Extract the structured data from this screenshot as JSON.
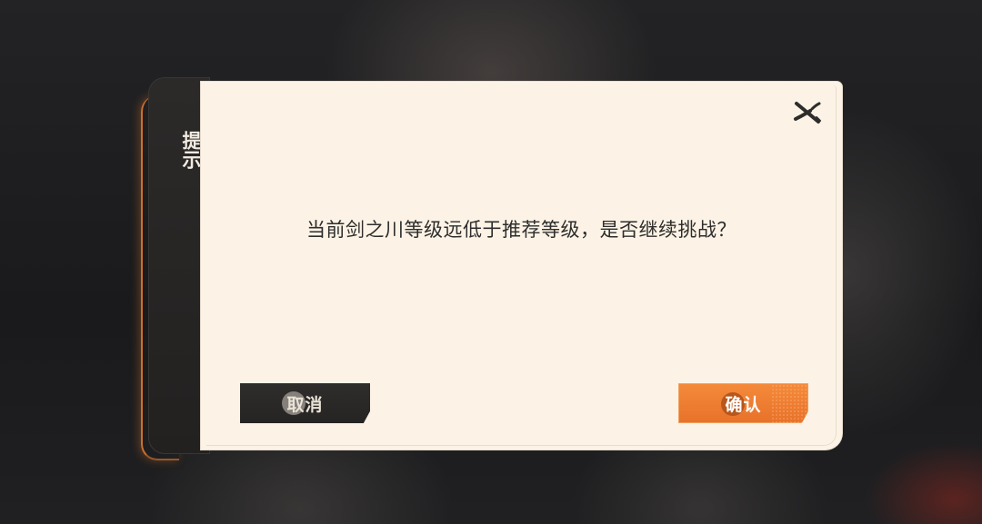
{
  "dialog": {
    "title": "提示",
    "message": "当前剑之川等级远低于推荐等级，是否继续挑战？",
    "close_icon": "close-icon",
    "buttons": {
      "cancel_label": "取消",
      "confirm_label": "确认"
    }
  },
  "colors": {
    "panel_bg": "#fcf3e6",
    "tab_bg": "#2c2a29",
    "accent_orange": "#f0802f",
    "cancel_bg": "#2f2d2c",
    "text_dark": "#2e2d2c"
  }
}
